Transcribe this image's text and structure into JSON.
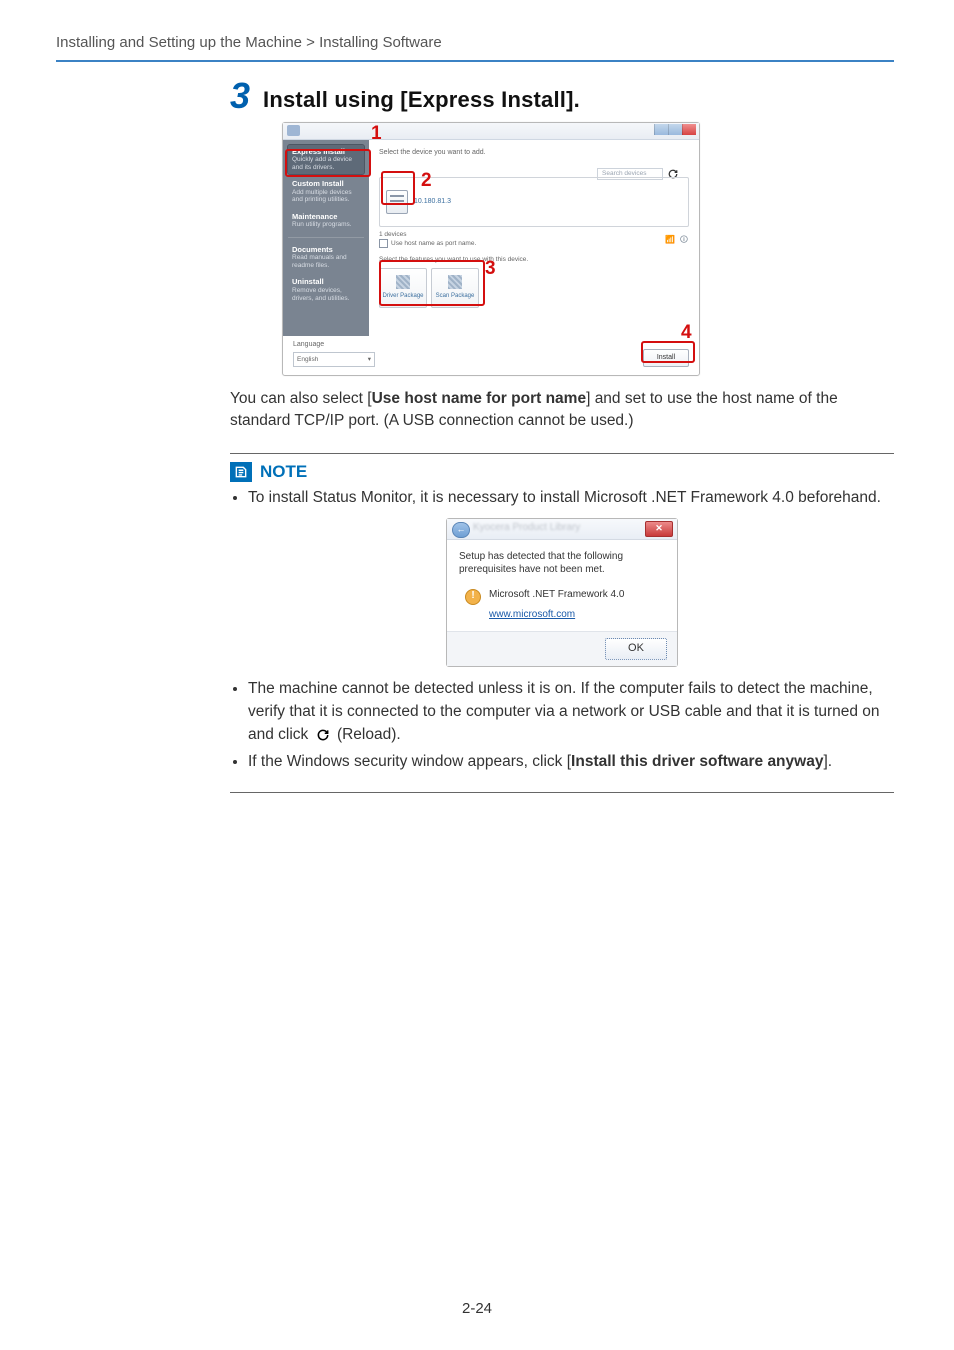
{
  "breadcrumb": "Installing and Setting up the Machine > Installing Software",
  "step_number": "3",
  "step_heading": "Install using [Express Install].",
  "para_host": {
    "pre": "You can also select [",
    "bold": "Use host name for port name",
    "post": "] and set to use the host name of the standard TCP/IP port. (A USB connection cannot be used.)"
  },
  "installer": {
    "sidebar": {
      "express": {
        "title": "Express Install",
        "sub": "Quickly add a device and its drivers."
      },
      "custom": {
        "title": "Custom Install",
        "sub": "Add multiple devices and printing utilities."
      },
      "maint": {
        "title": "Maintenance",
        "sub": "Run utility programs."
      },
      "docs": {
        "title": "Documents",
        "sub": "Read manuals and readme files."
      },
      "uninst": {
        "title": "Uninstall",
        "sub": "Remove devices, drivers, and utilities."
      }
    },
    "select_label": "Select the device you want to add.",
    "search_placeholder": "Search devices",
    "device_ip": "10.180.81.3",
    "device_count": "1 devices",
    "use_host_label": "Use host name as port name.",
    "features_label": "Select the features you want to use with this device.",
    "feature1": "Driver Package",
    "feature2": "Scan Package",
    "language_label": "Language",
    "language_value": "English",
    "install_btn": "Install",
    "callouts": {
      "c1": "1",
      "c2": "2",
      "c3": "3",
      "c4": "4"
    }
  },
  "note": {
    "label": "NOTE",
    "status_monitor": "To install Status Monitor, it is necessary to install Microsoft .NET Framework 4.0 beforehand.",
    "detect_pre": "The machine cannot be detected unless it is on. If the computer fails to detect the machine, verify that it is connected to the computer via a network or USB cable and that it is turned on and click ",
    "detect_reload": " (Reload).",
    "security_pre": "If the Windows security window appears, click [",
    "security_bold": "Install this driver software anyway",
    "security_post": "]."
  },
  "prereq_dialog": {
    "title": "Kyocera Product Library",
    "msg": "Setup has detected that the following prerequisites have not been met.",
    "item": "Microsoft .NET Framework 4.0",
    "link": "www.microsoft.com",
    "ok": "OK"
  },
  "page_number": "2-24"
}
